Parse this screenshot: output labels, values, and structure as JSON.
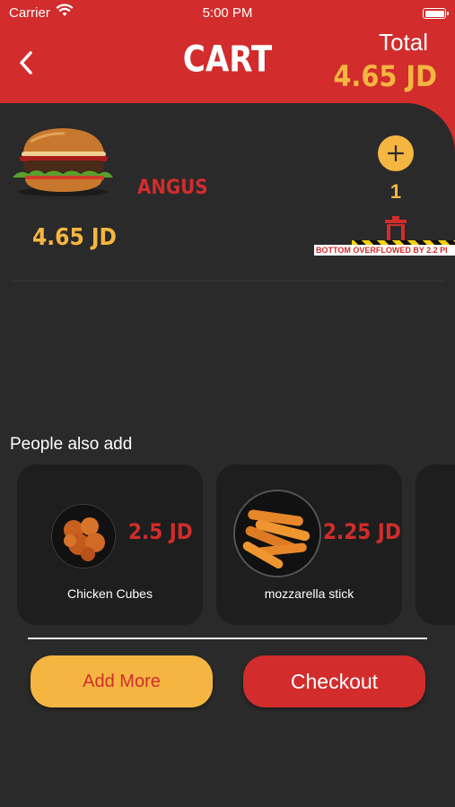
{
  "status_bar": {
    "carrier": "Carrier",
    "time": "5:00 PM"
  },
  "header": {
    "title": "CART",
    "total_label": "Total",
    "total_value": "4.65 JD"
  },
  "cart_items": [
    {
      "name": "ANGUS",
      "price": "4.65 JD",
      "quantity": "1"
    }
  ],
  "overflow_warning": "BOTTOM OVERFLOWED BY 2.2 PI",
  "suggestions": {
    "heading": "People also add",
    "items": [
      {
        "name": "Chicken Cubes",
        "price": "2.5 JD"
      },
      {
        "name": "mozzarella stick",
        "price": "2.25 JD"
      }
    ]
  },
  "buttons": {
    "add_more": "Add More",
    "checkout": "Checkout"
  },
  "colors": {
    "brand_red": "#d22c2c",
    "accent_yellow": "#f5b641",
    "background": "#2a2a2a",
    "card": "#1e1e1e"
  }
}
